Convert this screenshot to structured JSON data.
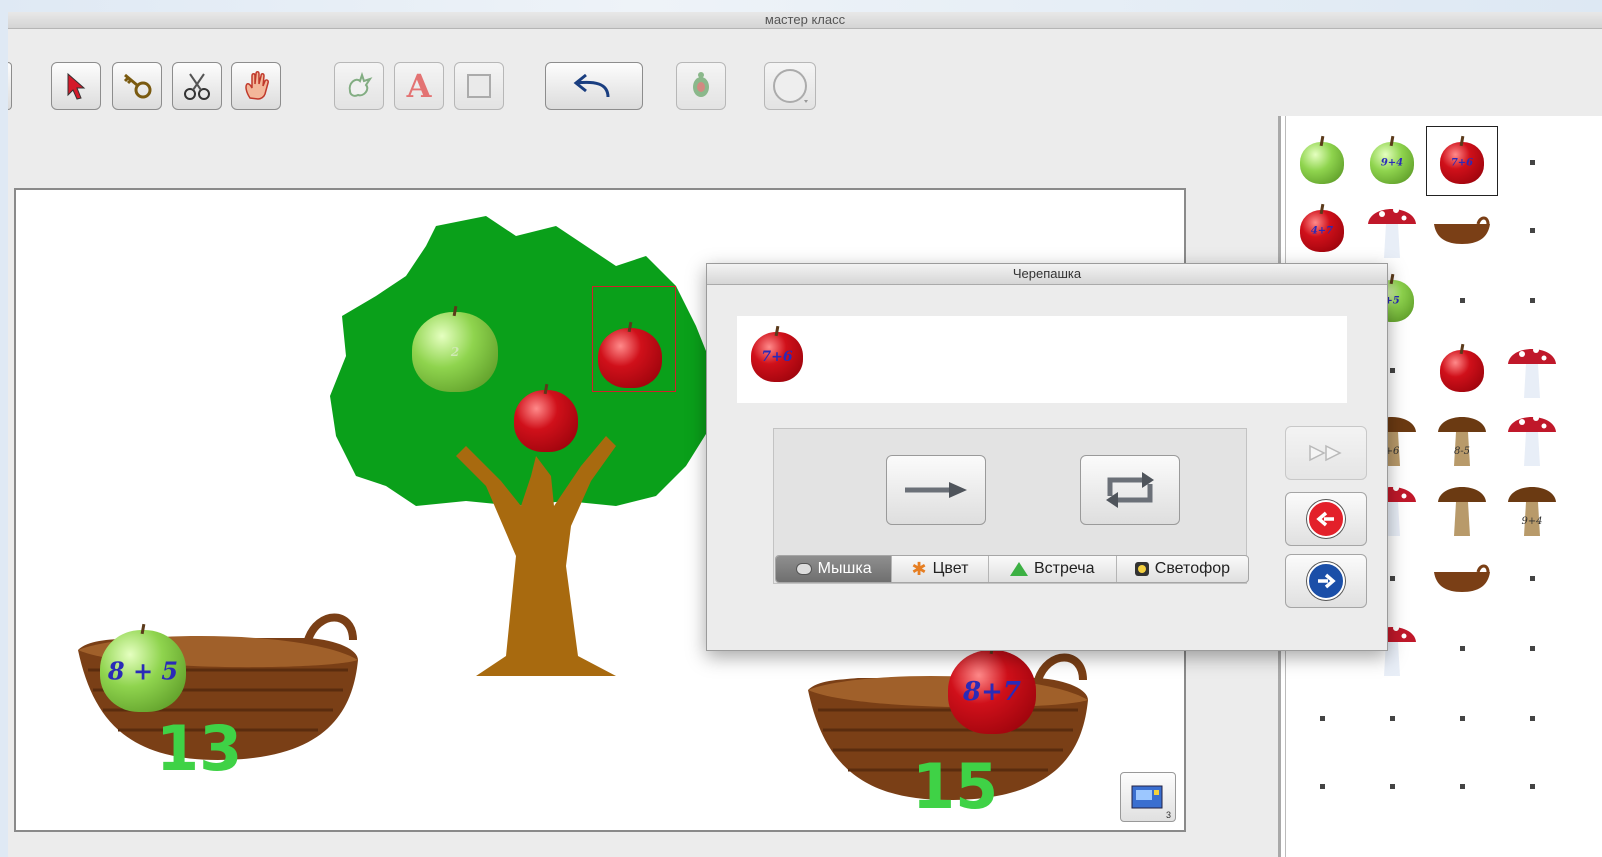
{
  "window": {
    "title": "мастер класс"
  },
  "toolbar": {
    "tools": [
      {
        "name": "arrow-tool",
        "icon": "pointer-arrow-icon"
      },
      {
        "name": "key-tool",
        "icon": "key-icon"
      },
      {
        "name": "scissors-tool",
        "icon": "scissors-icon"
      },
      {
        "name": "hand-tool",
        "icon": "hand-icon"
      },
      {
        "name": "shape-tool",
        "icon": "splat-icon"
      },
      {
        "name": "text-tool",
        "icon": "letter-a-icon",
        "label": "A"
      },
      {
        "name": "rect-tool",
        "icon": "square-icon"
      },
      {
        "name": "undo",
        "icon": "undo-arrow-icon"
      },
      {
        "name": "turtle-tool",
        "icon": "turtle-icon"
      },
      {
        "name": "circle-tool",
        "icon": "circle-icon"
      }
    ]
  },
  "canvas": {
    "apples_on_tree": [
      {
        "color": "green",
        "label": "2"
      },
      {
        "color": "red",
        "label": "",
        "selected": true
      },
      {
        "color": "red",
        "label": ""
      }
    ],
    "basket_left": {
      "apple_color": "green",
      "apple_label": "8 + 5",
      "number": "13"
    },
    "basket_right": {
      "apple_color": "red",
      "apple_label": "8+7",
      "number": "15"
    },
    "corner_badge": "3"
  },
  "palette": {
    "items": [
      {
        "kind": "apple-green",
        "label": ""
      },
      {
        "kind": "apple-green",
        "label": "9+4"
      },
      {
        "kind": "apple-red",
        "label": "7+6",
        "selected": true
      },
      {
        "kind": "apple-red",
        "label": "4+7"
      },
      {
        "kind": "mushroom-red",
        "label": ""
      },
      {
        "kind": "basket",
        "label": ""
      },
      {
        "kind": "apple-green",
        "label": "+5"
      },
      {
        "kind": "apple-red",
        "label": ""
      },
      {
        "kind": "mushroom-red",
        "label": ""
      },
      {
        "kind": "mushroom-brown",
        "label": "+6"
      },
      {
        "kind": "mushroom-brown",
        "label": "8-5"
      },
      {
        "kind": "mushroom-red",
        "label": ""
      },
      {
        "kind": "mushroom-red",
        "label": ""
      },
      {
        "kind": "mushroom-brown",
        "label": ""
      },
      {
        "kind": "mushroom-brown",
        "label": "9+4"
      },
      {
        "kind": "basket",
        "label": ""
      },
      {
        "kind": "mushroom-red",
        "label": ""
      }
    ]
  },
  "turtle_dialog": {
    "title": "Черепашка",
    "input_apple_label": "7+6",
    "tabs": [
      {
        "label": "Мышка",
        "icon": "mouse-icon",
        "active": true
      },
      {
        "label": "Цвет",
        "icon": "color-star-icon",
        "active": false
      },
      {
        "label": "Встреча",
        "icon": "meeting-icon",
        "active": false
      },
      {
        "label": "Светофор",
        "icon": "traffic-light-icon",
        "active": false
      }
    ],
    "colors": {
      "back": "#e3202a",
      "forward": "#1b4fa8"
    }
  }
}
